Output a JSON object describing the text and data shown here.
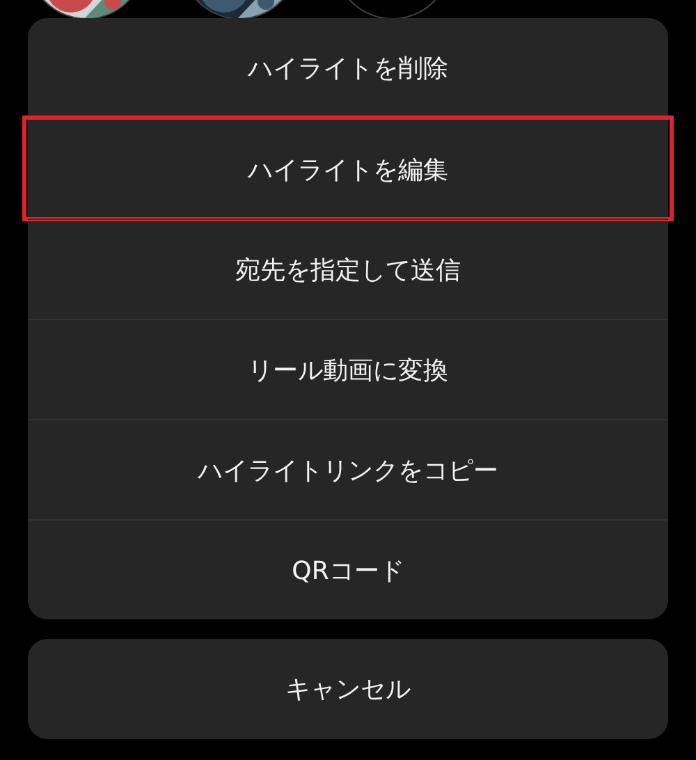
{
  "background": {
    "thumbnails": [
      {
        "kind": "picture"
      },
      {
        "kind": "picture"
      },
      {
        "kind": "empty"
      }
    ]
  },
  "action_sheet": {
    "items": [
      {
        "label": "ハイライトを削除",
        "highlighted": false
      },
      {
        "label": "ハイライトを編集",
        "highlighted": true
      },
      {
        "label": "宛先を指定して送信",
        "highlighted": false
      },
      {
        "label": "リール動画に変換",
        "highlighted": false
      },
      {
        "label": "ハイライトリンクをコピー",
        "highlighted": false
      },
      {
        "label": "QRコード",
        "highlighted": false
      }
    ]
  },
  "cancel_button": {
    "label": "キャンセル"
  }
}
